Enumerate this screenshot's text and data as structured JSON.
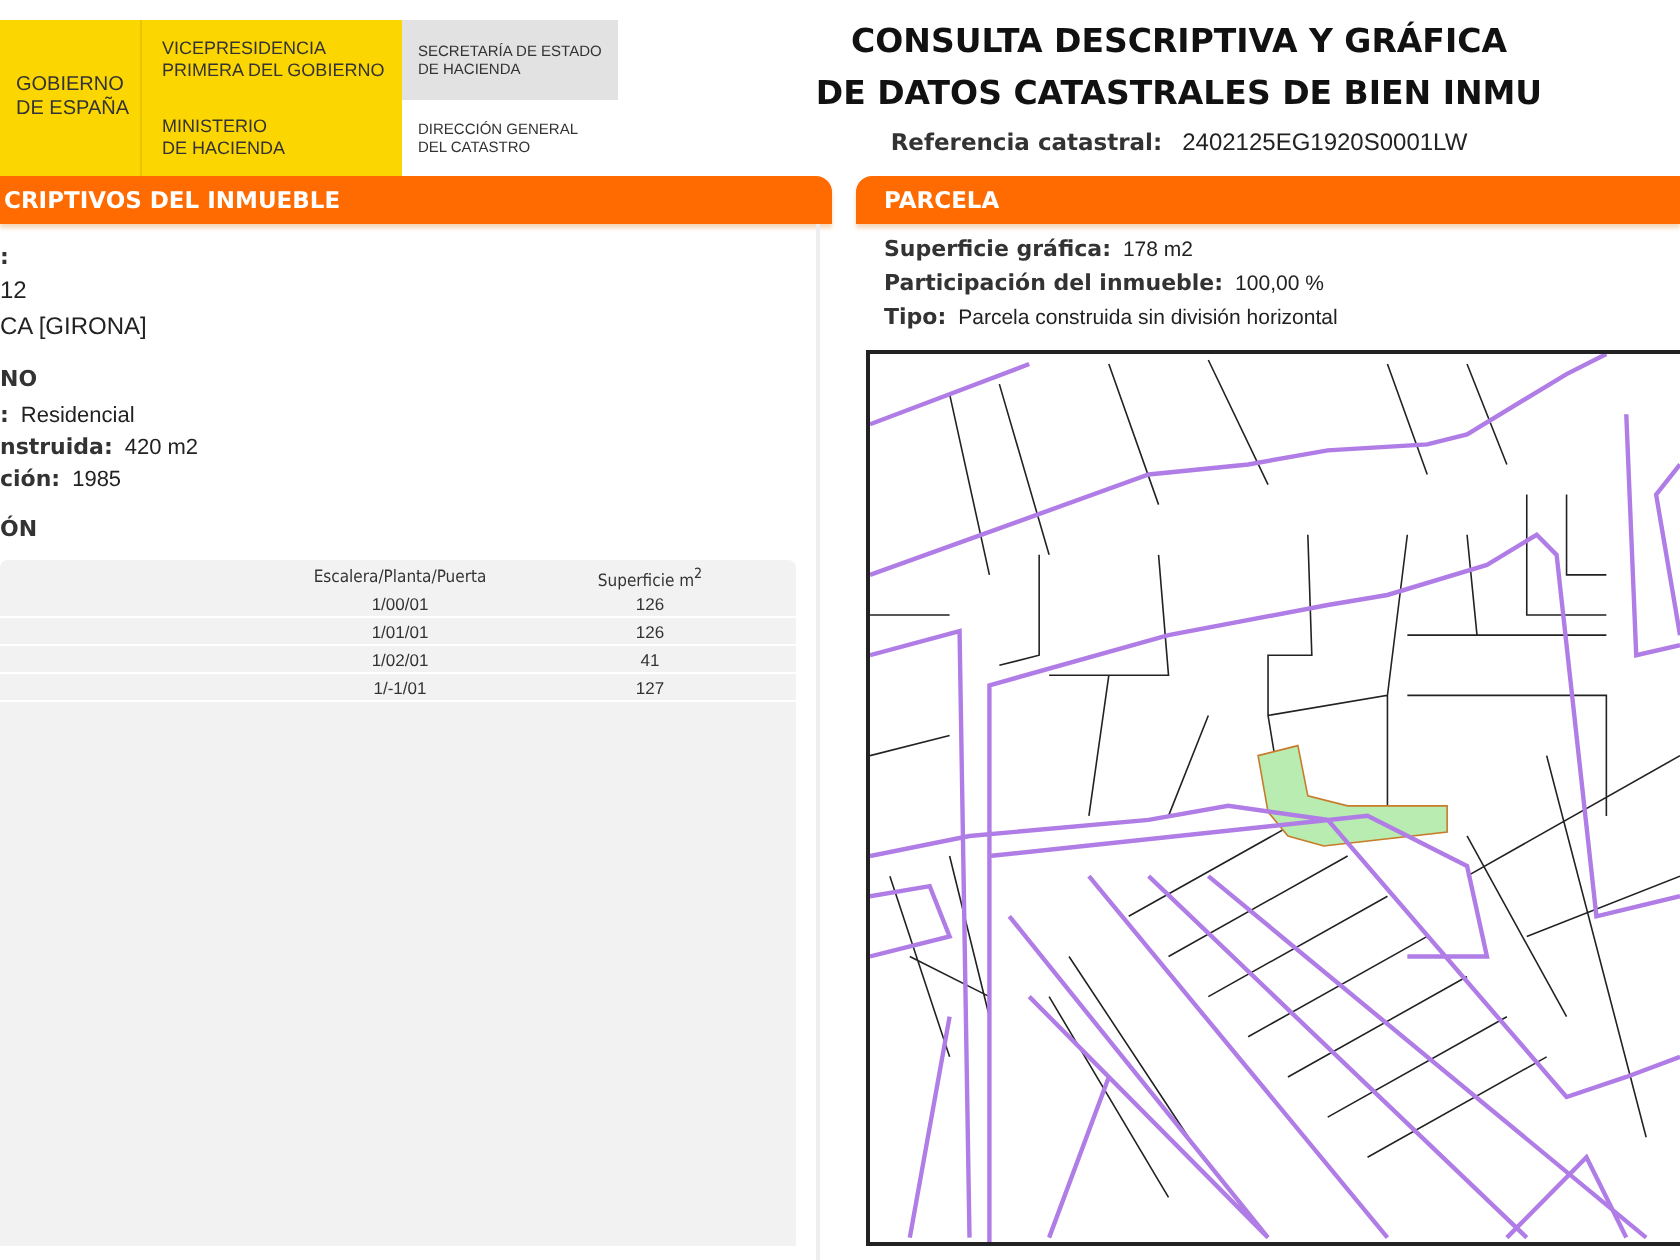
{
  "header": {
    "logo": {
      "government": [
        "GOBIERNO",
        "DE ESPAÑA"
      ],
      "vicepresidency": [
        "VICEPRESIDENCIA",
        "PRIMERA DEL GOBIERNO"
      ],
      "ministry": [
        "MINISTERIO",
        "DE HACIENDA"
      ],
      "secretariat": [
        "SECRETARÍA DE ESTADO",
        "DE HACIENDA"
      ],
      "directorate": [
        "DIRECCIÓN GENERAL",
        "DEL CATASTRO"
      ]
    },
    "title_lines": [
      "CONSULTA DESCRIPTIVA Y GRÁFICA",
      "DE DATOS CATASTRALES DE BIEN INMU"
    ],
    "reference": {
      "label": "Referencia catastral:",
      "value": "2402125EG1920S0001LW"
    }
  },
  "left_panel": {
    "title": "CRIPTIVOS DEL INMUEBLE",
    "items": [
      {
        "kind": "label",
        "label": ":"
      },
      {
        "kind": "value",
        "value": "12"
      },
      {
        "kind": "value",
        "value": "CA [GIRONA]"
      },
      {
        "kind": "section",
        "label": "NO"
      },
      {
        "kind": "pair",
        "label": ":",
        "value": "Residencial"
      },
      {
        "kind": "pair",
        "label": "nstruida:",
        "value": "420 m2"
      },
      {
        "kind": "pair",
        "label": "ción:",
        "value": "1985"
      },
      {
        "kind": "section",
        "label": "ÓN"
      }
    ],
    "table": {
      "columns": [
        "Escalera/Planta/Puerta",
        "Superficie m$^{2}$"
      ],
      "rows": [
        [
          "1/00/01",
          "126"
        ],
        [
          "1/01/01",
          "126"
        ],
        [
          "1/02/01",
          "41"
        ],
        [
          "1/-1/01",
          "127"
        ]
      ]
    }
  },
  "right_panel": {
    "title": "PARCELA",
    "fields": [
      {
        "label": "Superficie gráfica:",
        "value": "178 m2"
      },
      {
        "label": "Participación del inmueble:",
        "value": "100,00 %"
      },
      {
        "label": "Tipo:",
        "value": "Parcela construida sin división horizontal"
      }
    ]
  }
}
